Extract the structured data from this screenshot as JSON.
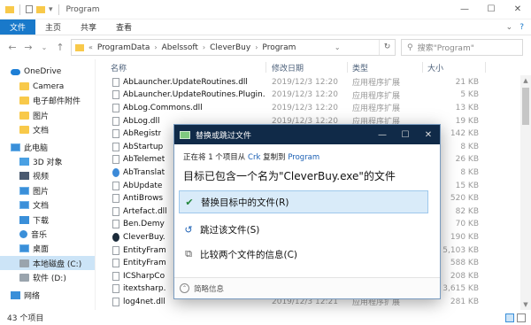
{
  "window": {
    "title": "Program"
  },
  "ribbon": {
    "tabs": [
      "文件",
      "主页",
      "共享",
      "查看"
    ],
    "active": 0
  },
  "address": {
    "crumbs": [
      "ProgramData",
      "Abelssoft",
      "CleverBuy",
      "Program"
    ],
    "search_placeholder": "搜索\"Program\""
  },
  "sidebar": {
    "items": [
      {
        "label": "OneDrive",
        "icon": "cloud"
      },
      {
        "label": "Camera",
        "icon": "folder"
      },
      {
        "label": "电子邮件附件",
        "icon": "folder"
      },
      {
        "label": "图片",
        "icon": "folder"
      },
      {
        "label": "文档",
        "icon": "folder"
      },
      {
        "label": "此电脑",
        "icon": "pc"
      },
      {
        "label": "3D 对象",
        "icon": "obj3d"
      },
      {
        "label": "视频",
        "icon": "video"
      },
      {
        "label": "图片",
        "icon": "pc"
      },
      {
        "label": "文档",
        "icon": "pc"
      },
      {
        "label": "下载",
        "icon": "dl"
      },
      {
        "label": "音乐",
        "icon": "music"
      },
      {
        "label": "桌面",
        "icon": "pc"
      },
      {
        "label": "本地磁盘 (C:)",
        "icon": "drive",
        "selected": true
      },
      {
        "label": "软件 (D:)",
        "icon": "drive"
      },
      {
        "label": "网络",
        "icon": "net"
      }
    ]
  },
  "columns": {
    "name": "名称",
    "date": "修改日期",
    "type": "类型",
    "size": "大小"
  },
  "files": [
    {
      "name": "AbLauncher.UpdateRoutines.dll",
      "date": "2019/12/3 12:20",
      "type": "应用程序扩展",
      "size": "21 KB",
      "icon": "dll"
    },
    {
      "name": "AbLauncher.UpdateRoutines.Plugin.B...",
      "date": "2019/12/3 12:20",
      "type": "应用程序扩展",
      "size": "5 KB",
      "icon": "dll"
    },
    {
      "name": "AbLog.Commons.dll",
      "date": "2019/12/3 12:20",
      "type": "应用程序扩展",
      "size": "13 KB",
      "icon": "dll"
    },
    {
      "name": "AbLog.dll",
      "date": "2019/12/3 12:20",
      "type": "应用程序扩展",
      "size": "19 KB",
      "icon": "dll"
    },
    {
      "name": "AbRegistr",
      "date": "",
      "type": "",
      "size": "142 KB",
      "icon": "dll"
    },
    {
      "name": "AbStartup",
      "date": "",
      "type": "",
      "size": "8 KB",
      "icon": "dll"
    },
    {
      "name": "AbTelemet",
      "date": "",
      "type": "",
      "size": "26 KB",
      "icon": "dll"
    },
    {
      "name": "AbTranslat",
      "date": "",
      "type": "",
      "size": "8 KB",
      "icon": "gear"
    },
    {
      "name": "AbUpdate",
      "date": "",
      "type": "",
      "size": "15 KB",
      "icon": "dll"
    },
    {
      "name": "AntiBrows",
      "date": "",
      "type": "",
      "size": "520 KB",
      "icon": "dll"
    },
    {
      "name": "Artefact.dll",
      "date": "",
      "type": "",
      "size": "82 KB",
      "icon": "dll"
    },
    {
      "name": "Ben.Demy",
      "date": "",
      "type": "",
      "size": "70 KB",
      "icon": "dll"
    },
    {
      "name": "CleverBuy.",
      "date": "",
      "type": "",
      "size": "190 KB",
      "icon": "exe"
    },
    {
      "name": "EntityFram",
      "date": "",
      "type": "",
      "size": "5,103 KB",
      "icon": "dll"
    },
    {
      "name": "EntityFram",
      "date": "",
      "type": "",
      "size": "588 KB",
      "icon": "dll"
    },
    {
      "name": "ICSharpCo",
      "date": "",
      "type": "",
      "size": "208 KB",
      "icon": "dll"
    },
    {
      "name": "itextsharp.",
      "date": "",
      "type": "",
      "size": "3,615 KB",
      "icon": "dll"
    },
    {
      "name": "log4net.dll",
      "date": "2019/12/3 12:21",
      "type": "应用程序扩展",
      "size": "281 KB",
      "icon": "dll"
    }
  ],
  "status": {
    "count": "43 个项目"
  },
  "dialog": {
    "title": "替换或跳过文件",
    "sub_prefix": "正在将 1 个项目从",
    "sub_from": "Crk",
    "sub_mid": "复制到",
    "sub_to": "Program",
    "headline": "目标已包含一个名为\"CleverBuy.exe\"的文件",
    "options": [
      {
        "label": "替换目标中的文件(R)",
        "icon": "check-icon"
      },
      {
        "label": "跳过该文件(S)",
        "icon": "skip-icon"
      },
      {
        "label": "比较两个文件的信息(C)",
        "icon": "compare-icon"
      }
    ],
    "footer": "简略信息"
  }
}
